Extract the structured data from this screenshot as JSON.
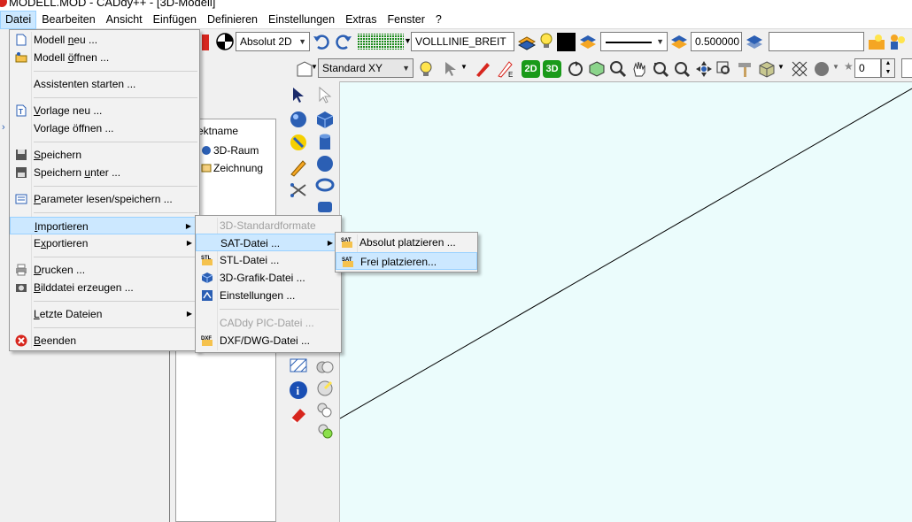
{
  "window": {
    "title": "MODELL.MOD  -  CADdy++ - [3D-Modell]"
  },
  "menubar": [
    {
      "label": "Datei",
      "active": true
    },
    {
      "label": "Bearbeiten"
    },
    {
      "label": "Ansicht"
    },
    {
      "label": "Einfügen"
    },
    {
      "label": "Definieren"
    },
    {
      "label": "Einstellungen"
    },
    {
      "label": "Extras"
    },
    {
      "label": "Fenster"
    },
    {
      "label": "?"
    }
  ],
  "toolbar1": {
    "coord_mode": "Absolut 2D",
    "line_type": "VOLLLINIE_BREIT",
    "line_width": "0.500000",
    "layer_name": "",
    "colors": {
      "pen": "#000000",
      "accent": "#f5a623"
    }
  },
  "toolbar2": {
    "view_plane": "Standard XY",
    "snap_value": "0",
    "btn_2d": "2D",
    "btn_3d": "3D"
  },
  "explorer": {
    "column_header": "ektname",
    "items": [
      "3D-Raum",
      "Zeichnung"
    ]
  },
  "datei_menu": {
    "items": [
      {
        "label": "Modell neu ...",
        "ul": "n",
        "icon": "new-model-icon"
      },
      {
        "label": "Modell öffnen ...",
        "ul": "ö",
        "icon": "open-model-icon"
      },
      {
        "label": "Assistenten starten ...",
        "icon": ""
      },
      {
        "label": "Vorlage neu ...",
        "ul": "V",
        "icon": "new-template-icon"
      },
      {
        "label": "Vorlage öffnen ...",
        "icon": ""
      },
      {
        "label": "Speichern",
        "ul": "S",
        "icon": "save-icon"
      },
      {
        "label": "Speichern unter ...",
        "ul": "u",
        "icon": "save-as-icon"
      },
      {
        "label": "Parameter lesen/speichern ...",
        "ul": "P",
        "icon": "parameter-icon"
      },
      {
        "label": "Importieren",
        "ul": "I",
        "icon": ""
      },
      {
        "label": "Exportieren",
        "ul": "x",
        "icon": ""
      },
      {
        "label": "Drucken ...",
        "ul": "D",
        "icon": "print-icon"
      },
      {
        "label": "Bilddatei erzeugen ...",
        "ul": "B",
        "icon": "camera-icon"
      },
      {
        "label": "Letzte Dateien",
        "ul": "L",
        "icon": ""
      },
      {
        "label": "Beenden",
        "ul": "B",
        "icon": "exit-icon"
      }
    ]
  },
  "import_menu": {
    "items": [
      {
        "label": "3D-Standardformate",
        "disabled": true
      },
      {
        "label": "SAT-Datei ..."
      },
      {
        "label": "STL-Datei ..."
      },
      {
        "label": "3D-Grafik-Datei ..."
      },
      {
        "label": "Einstellungen ..."
      },
      {
        "label": "CADdy PIC-Datei ...",
        "disabled": true
      },
      {
        "label": "DXF/DWG-Datei ..."
      }
    ]
  },
  "sat_menu": {
    "items": [
      {
        "label": "Absolut platzieren ..."
      },
      {
        "label": "Frei platzieren..."
      }
    ]
  },
  "icon_text": {
    "sat": "SAT",
    "stl": "STL",
    "dxf": "DXF"
  },
  "viewport": {
    "background": "#ebfcfc"
  }
}
